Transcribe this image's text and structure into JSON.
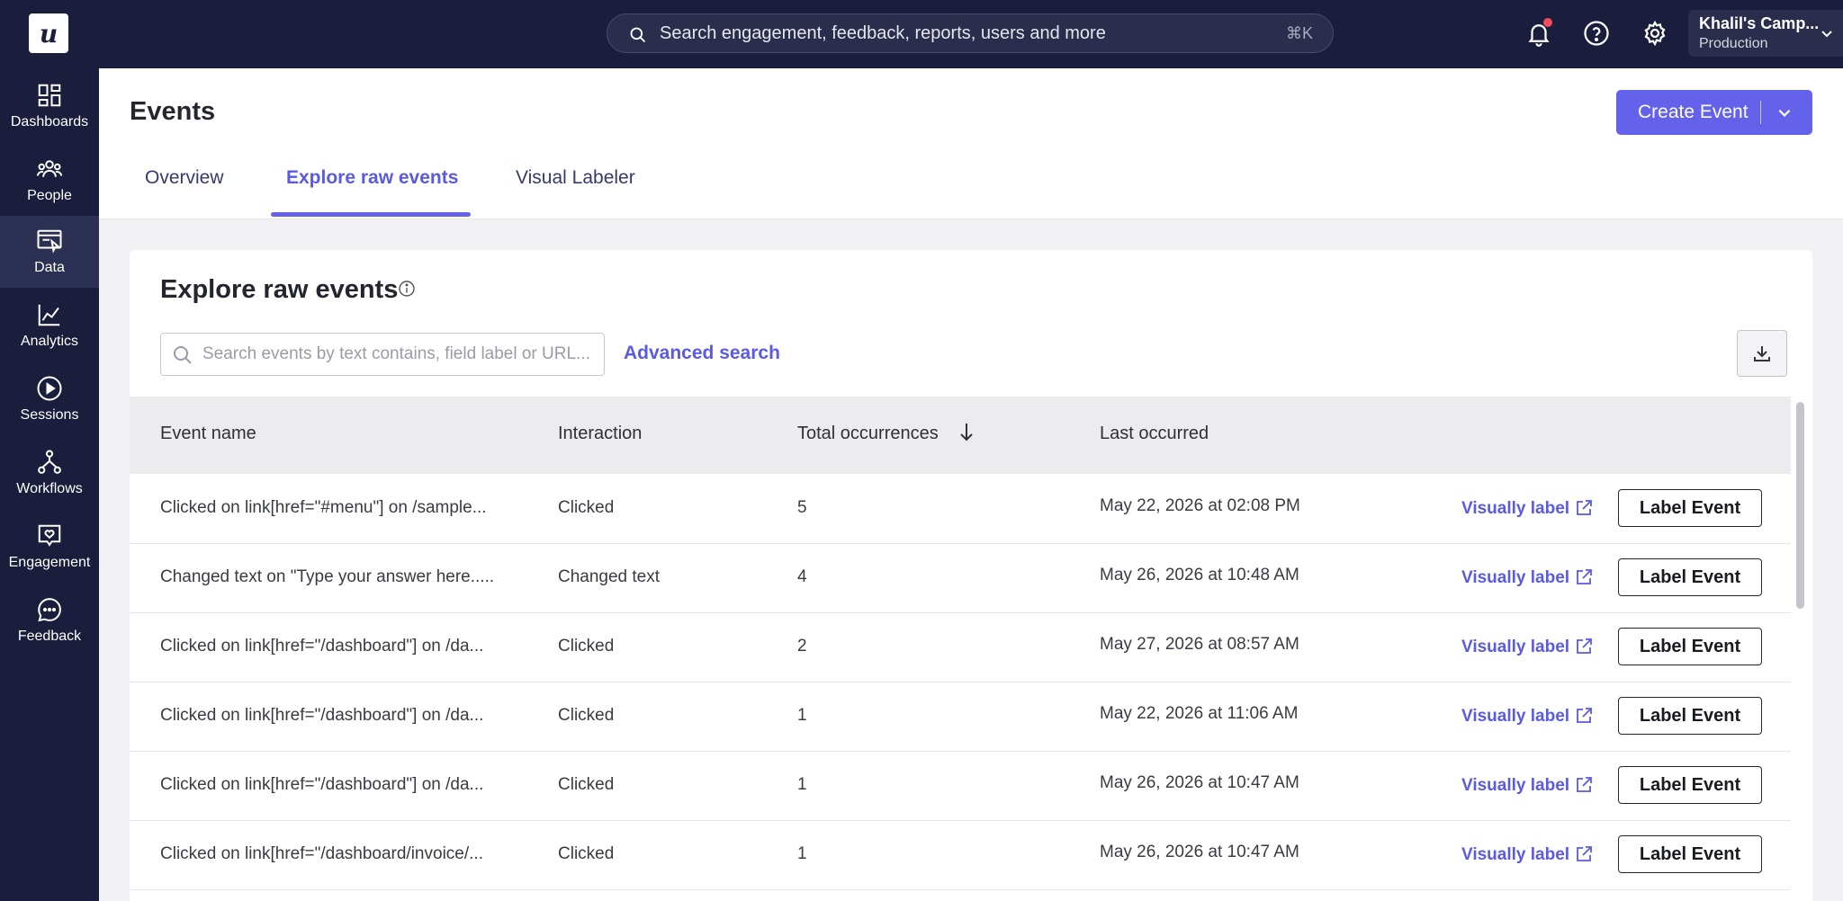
{
  "topbar": {
    "logo_text": "u",
    "search_placeholder": "Search engagement, feedback, reports, users and more",
    "search_shortcut": "⌘K",
    "account_name": "Khalil's Camp...",
    "account_env": "Production"
  },
  "sidebar": {
    "items": [
      {
        "label": "Dashboards",
        "icon": "dashboard-icon"
      },
      {
        "label": "People",
        "icon": "people-icon"
      },
      {
        "label": "Data",
        "icon": "data-icon",
        "active": true
      },
      {
        "label": "Analytics",
        "icon": "analytics-icon"
      },
      {
        "label": "Sessions",
        "icon": "play-icon"
      },
      {
        "label": "Workflows",
        "icon": "workflow-icon"
      },
      {
        "label": "Engagement",
        "icon": "engagement-icon"
      },
      {
        "label": "Feedback",
        "icon": "chat-icon"
      }
    ]
  },
  "header": {
    "title": "Events",
    "create_label": "Create Event",
    "tabs": [
      {
        "label": "Overview"
      },
      {
        "label": "Explore raw events",
        "active": true
      },
      {
        "label": "Visual Labeler"
      }
    ]
  },
  "card": {
    "title": "Explore raw events",
    "search_placeholder": "Search events by text contains, field label or URL...",
    "advanced_search": "Advanced search"
  },
  "table": {
    "columns": [
      "Event name",
      "Interaction",
      "Total occurrences",
      "Last occurred"
    ],
    "visually_label": "Visually label",
    "label_event": "Label Event",
    "rows": [
      {
        "name": "Clicked on link[href=\"#menu\"] on /sample...",
        "interaction": "Clicked",
        "count": "5",
        "last": "May 22, 2026 at 02:08 PM"
      },
      {
        "name": "Changed text on \"Type your answer here.....",
        "interaction": "Changed text",
        "count": "4",
        "last": "May 26, 2026 at 10:48 AM"
      },
      {
        "name": "Clicked on link[href=\"/dashboard\"] on /da...",
        "interaction": "Clicked",
        "count": "2",
        "last": "May 27, 2026 at 08:57 AM"
      },
      {
        "name": "Clicked on link[href=\"/dashboard\"] on /da...",
        "interaction": "Clicked",
        "count": "1",
        "last": "May 22, 2026 at 11:06 AM"
      },
      {
        "name": "Clicked on link[href=\"/dashboard\"] on /da...",
        "interaction": "Clicked",
        "count": "1",
        "last": "May 26, 2026 at 10:47 AM"
      },
      {
        "name": "Clicked on link[href=\"/dashboard/invoice/...",
        "interaction": "Clicked",
        "count": "1",
        "last": "May 26, 2026 at 10:47 AM"
      }
    ]
  }
}
